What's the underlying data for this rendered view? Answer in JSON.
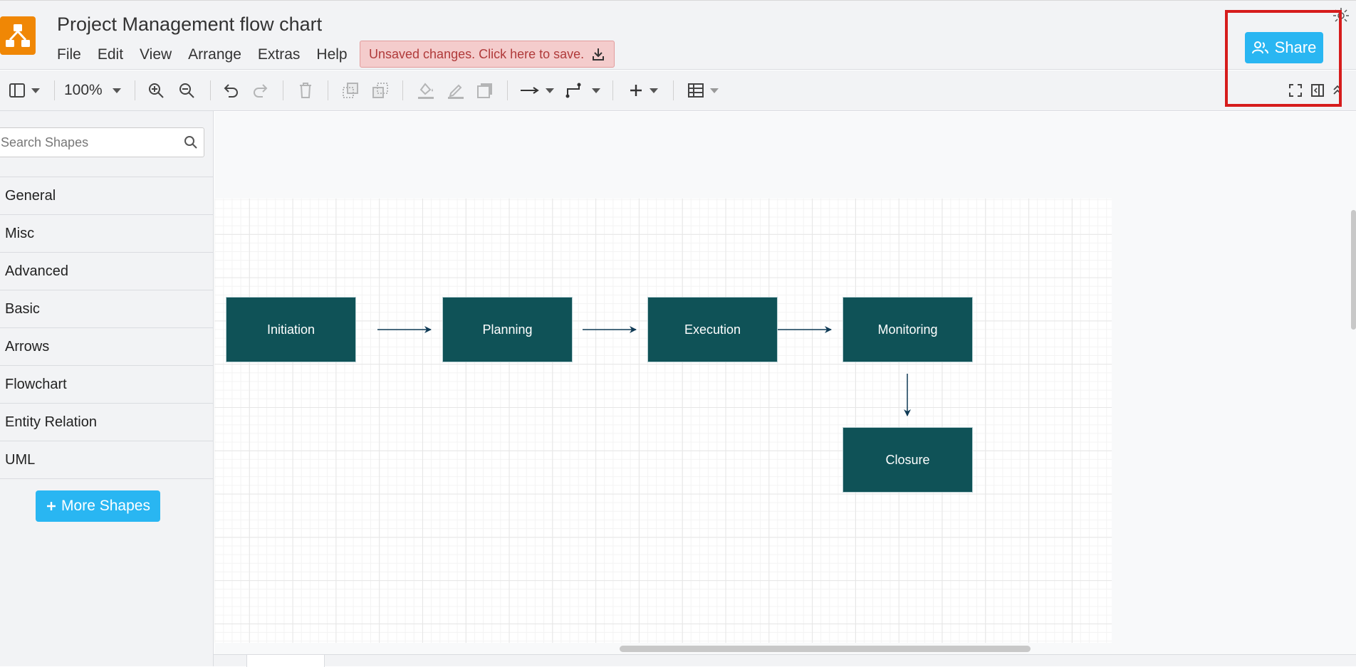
{
  "app": {
    "title": "Project Management flow chart",
    "menu": [
      "File",
      "Edit",
      "View",
      "Arrange",
      "Extras",
      "Help"
    ],
    "unsaved_label": "Unsaved changes. Click here to save.",
    "share_label": "Share",
    "accent_color": "#29b6f2",
    "logo_color": "#f08705"
  },
  "toolbar": {
    "zoom": "100%",
    "icons": [
      "sidebar-toggle-icon",
      "zoom-in-icon",
      "zoom-out-icon",
      "undo-icon",
      "redo-icon",
      "delete-icon",
      "to-front-icon",
      "to-back-icon",
      "fill-color-icon",
      "line-color-icon",
      "shadow-icon",
      "connection-arrow-icon",
      "waypoints-icon",
      "insert-plus-icon",
      "table-icon",
      "fullscreen-icon",
      "format-panel-icon",
      "collapse-icon"
    ]
  },
  "sidebar": {
    "search_placeholder": "Search Shapes",
    "categories": [
      "General",
      "Misc",
      "Advanced",
      "Basic",
      "Arrows",
      "Flowchart",
      "Entity Relation",
      "UML"
    ],
    "more_shapes_label": "More Shapes"
  },
  "diagram": {
    "node_color": "#0f5257",
    "nodes": [
      "Initiation",
      "Planning",
      "Execution",
      "Monitoring",
      "Closure"
    ],
    "edges": [
      [
        "Initiation",
        "Planning"
      ],
      [
        "Planning",
        "Execution"
      ],
      [
        "Execution",
        "Monitoring"
      ],
      [
        "Monitoring",
        "Closure"
      ]
    ]
  }
}
